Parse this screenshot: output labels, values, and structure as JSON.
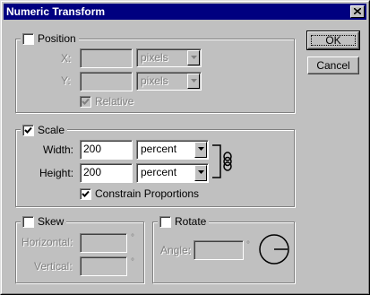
{
  "window": {
    "title": "Numeric Transform"
  },
  "buttons": {
    "ok": "OK",
    "cancel": "Cancel"
  },
  "position": {
    "label": "Position",
    "x_label": "X:",
    "y_label": "Y:",
    "x_value": "",
    "y_value": "",
    "x_unit": "pixels",
    "y_unit": "pixels",
    "relative_label": "Relative",
    "checked": false,
    "relative_checked": true
  },
  "scale": {
    "label": "Scale",
    "width_label": "Width:",
    "height_label": "Height:",
    "width_value": "200",
    "height_value": "200",
    "width_unit": "percent",
    "height_unit": "percent",
    "constrain_label": "Constrain Proportions",
    "checked": true,
    "constrain_checked": true
  },
  "skew": {
    "label": "Skew",
    "horizontal_label": "Horizontal:",
    "vertical_label": "Vertical:",
    "horizontal_value": "",
    "vertical_value": "",
    "degree_symbol": "°",
    "checked": false
  },
  "rotate": {
    "label": "Rotate",
    "angle_label": "Angle:",
    "angle_value": "",
    "degree_symbol": "°",
    "checked": false
  },
  "icons": [
    "close-icon",
    "checkmark-icon",
    "dropdown-arrow-icon",
    "link-icon",
    "angle-dial-icon"
  ]
}
